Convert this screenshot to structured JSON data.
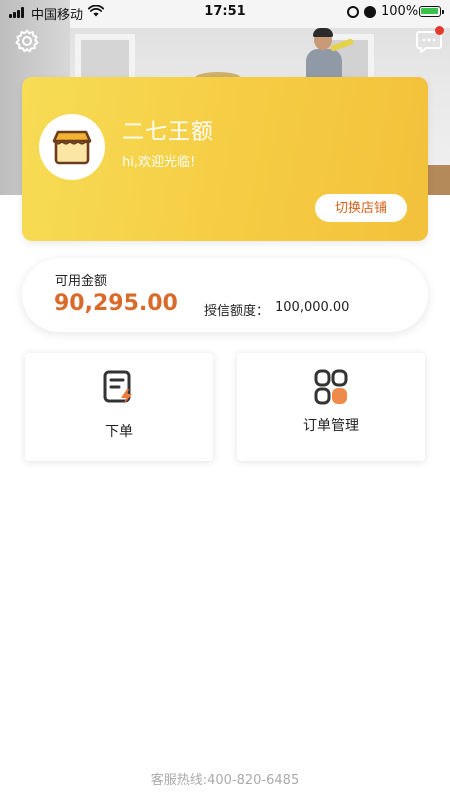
{
  "status_bar": {
    "carrier": "中国移动",
    "time": "17:51",
    "battery": "100%",
    "icons": [
      "signal-icon",
      "wifi-icon",
      "rotation-lock-icon",
      "alarm-icon",
      "battery-icon"
    ]
  },
  "header": {
    "left_icon": "gear-icon",
    "right_icon": "message-icon"
  },
  "store": {
    "name": "二七王额",
    "greeting": "hi,欢迎光临!",
    "switch_label": "切换店铺",
    "avatar_icon": "store-icon"
  },
  "balance": {
    "label": "可用金额",
    "amount": "90,295.00",
    "credit_label": "授信额度：",
    "credit_value": "100,000.00"
  },
  "actions": [
    {
      "label": "下单",
      "icon": "order-icon"
    },
    {
      "label": "订单管理",
      "icon": "grid-icon"
    }
  ],
  "footer": {
    "hotline": "客服热线:400-820-6485"
  },
  "colors": {
    "card_yellow": "#f5cc43",
    "accent_orange": "#d96a2a",
    "button_text": "#d8621c"
  }
}
